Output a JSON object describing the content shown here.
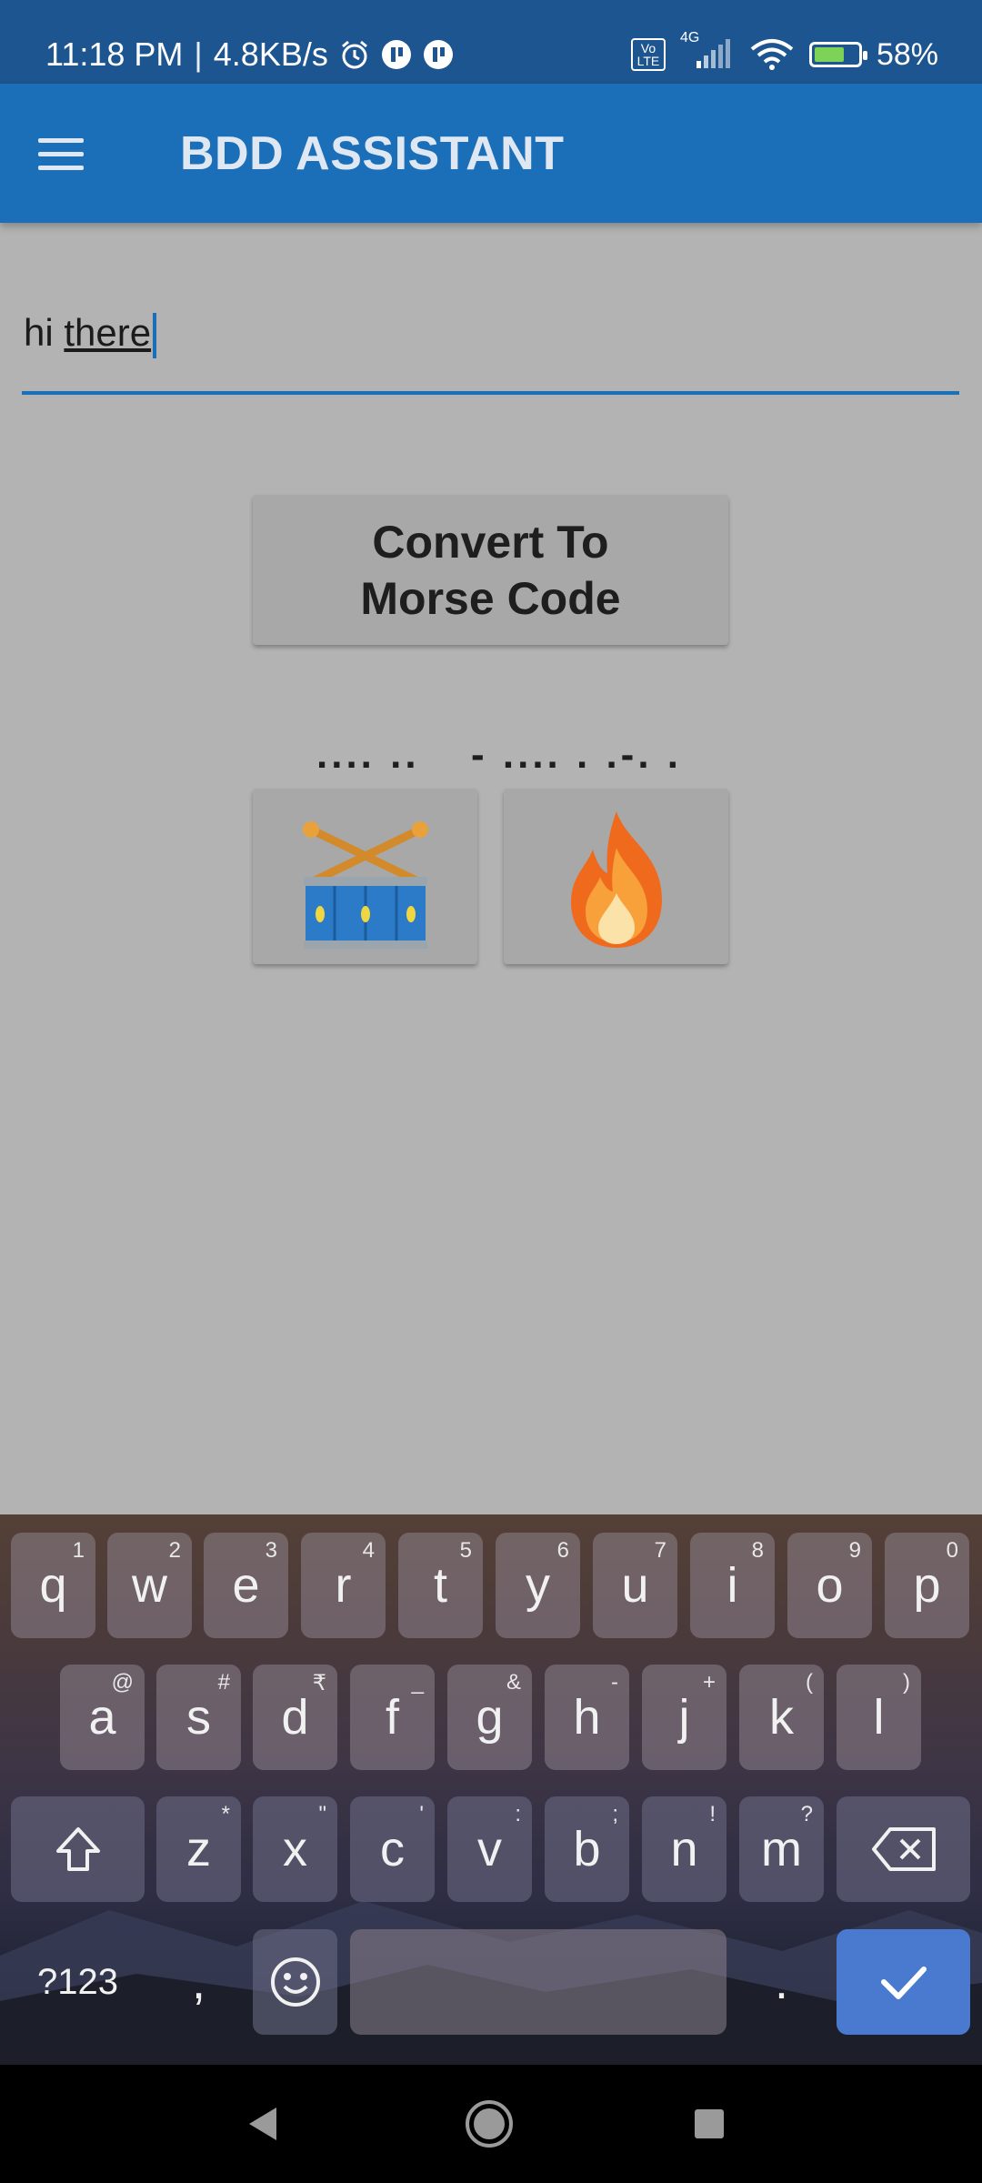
{
  "status_bar": {
    "time": "11:18 PM",
    "net_speed": "4.8KB/s",
    "network_type": "4G",
    "volte_badge": "Vo LTE",
    "battery": "58%"
  },
  "app_bar": {
    "title": "BDD ASSISTANT"
  },
  "input": {
    "value_first": "hi",
    "value_second": "there"
  },
  "convert_button": {
    "label_line1": "Convert To",
    "label_line2": "Morse Code"
  },
  "morse_output": [
    {
      "morse": ".... ..",
      "emoji": "drum"
    },
    {
      "morse": "- .... . .-. .",
      "emoji": "fire"
    }
  ],
  "keyboard": {
    "row1": [
      {
        "k": "q",
        "h": "1"
      },
      {
        "k": "w",
        "h": "2"
      },
      {
        "k": "e",
        "h": "3"
      },
      {
        "k": "r",
        "h": "4"
      },
      {
        "k": "t",
        "h": "5"
      },
      {
        "k": "y",
        "h": "6"
      },
      {
        "k": "u",
        "h": "7"
      },
      {
        "k": "i",
        "h": "8"
      },
      {
        "k": "o",
        "h": "9"
      },
      {
        "k": "p",
        "h": "0"
      }
    ],
    "row2": [
      {
        "k": "a",
        "h": "@"
      },
      {
        "k": "s",
        "h": "#"
      },
      {
        "k": "d",
        "h": "₹"
      },
      {
        "k": "f",
        "h": "_"
      },
      {
        "k": "g",
        "h": "&"
      },
      {
        "k": "h",
        "h": "-"
      },
      {
        "k": "j",
        "h": "+"
      },
      {
        "k": "k",
        "h": "("
      },
      {
        "k": "l",
        "h": ")"
      }
    ],
    "row3": [
      {
        "k": "z",
        "h": "*"
      },
      {
        "k": "x",
        "h": "\""
      },
      {
        "k": "c",
        "h": "'"
      },
      {
        "k": "v",
        "h": ":"
      },
      {
        "k": "b",
        "h": ";"
      },
      {
        "k": "n",
        "h": "!"
      },
      {
        "k": "m",
        "h": "?"
      }
    ],
    "symbols_label": "?123",
    "comma": ",",
    "period": "."
  },
  "icons": {
    "menu": "hamburger-menu-icon",
    "shift": "shift-icon",
    "backspace": "backspace-icon",
    "emoji": "emoji-icon",
    "enter": "checkmark-icon"
  },
  "colors": {
    "primary": "#1b6fb8",
    "status_bar": "#1d5590",
    "enter_key": "#4a7ad0"
  }
}
